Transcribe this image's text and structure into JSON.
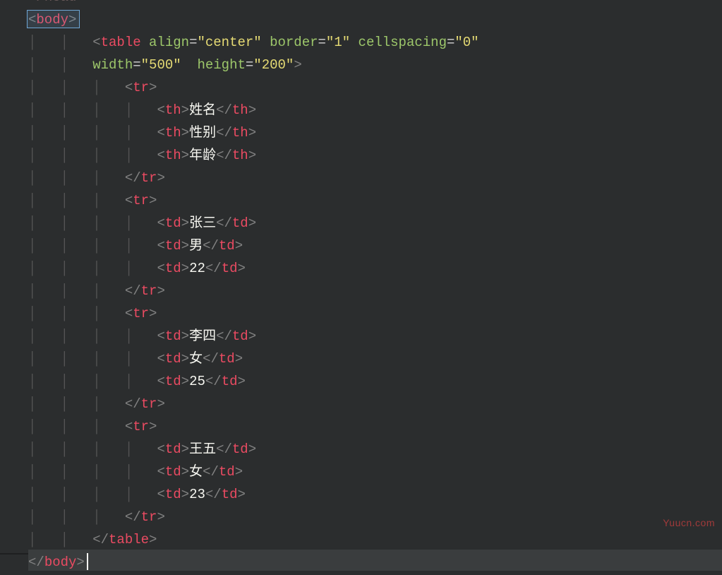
{
  "watermark": "Yuucn.com",
  "code": {
    "lines": [
      {
        "indent": 0,
        "sel": false,
        "tokens": [
          [
            "ig",
            "</"
          ],
          [
            "txt",
            "head"
          ],
          [
            "ig",
            ">"
          ]
        ],
        "faded": true
      },
      {
        "indent": 0,
        "sel": true,
        "tokens": [
          [
            "angle",
            "<"
          ],
          [
            "tag",
            "body"
          ],
          [
            "angle",
            ">"
          ]
        ]
      },
      {
        "indent": 2,
        "tokens": [
          [
            "angle",
            "<"
          ],
          [
            "tag",
            "table"
          ],
          [
            "txt",
            " "
          ],
          [
            "attr",
            "align"
          ],
          [
            "eq",
            "="
          ],
          [
            "str",
            "\"center\""
          ],
          [
            "txt",
            " "
          ],
          [
            "attr",
            "border"
          ],
          [
            "eq",
            "="
          ],
          [
            "str",
            "\"1\""
          ],
          [
            "txt",
            " "
          ],
          [
            "attr",
            "cellspacing"
          ],
          [
            "eq",
            "="
          ],
          [
            "str",
            "\"0\""
          ],
          [
            "txt",
            " "
          ]
        ]
      },
      {
        "indent": 2,
        "cont": true,
        "tokens": [
          [
            "attr",
            "width"
          ],
          [
            "eq",
            "="
          ],
          [
            "str",
            "\"500\""
          ],
          [
            "txt",
            "  "
          ],
          [
            "attr",
            "height"
          ],
          [
            "eq",
            "="
          ],
          [
            "str",
            "\"200\""
          ],
          [
            "angle",
            ">"
          ]
        ]
      },
      {
        "indent": 3,
        "tokens": [
          [
            "angle",
            "<"
          ],
          [
            "tag",
            "tr"
          ],
          [
            "angle",
            ">"
          ]
        ]
      },
      {
        "indent": 4,
        "tokens": [
          [
            "angle",
            "<"
          ],
          [
            "tag",
            "th"
          ],
          [
            "angle",
            ">"
          ],
          [
            "txt",
            "姓名"
          ],
          [
            "angle",
            "</"
          ],
          [
            "tag",
            "th"
          ],
          [
            "angle",
            ">"
          ]
        ]
      },
      {
        "indent": 4,
        "tokens": [
          [
            "angle",
            "<"
          ],
          [
            "tag",
            "th"
          ],
          [
            "angle",
            ">"
          ],
          [
            "txt",
            "性别"
          ],
          [
            "angle",
            "</"
          ],
          [
            "tag",
            "th"
          ],
          [
            "angle",
            ">"
          ]
        ]
      },
      {
        "indent": 4,
        "tokens": [
          [
            "angle",
            "<"
          ],
          [
            "tag",
            "th"
          ],
          [
            "angle",
            ">"
          ],
          [
            "txt",
            "年龄"
          ],
          [
            "angle",
            "</"
          ],
          [
            "tag",
            "th"
          ],
          [
            "angle",
            ">"
          ]
        ]
      },
      {
        "indent": 3,
        "tokens": [
          [
            "angle",
            "</"
          ],
          [
            "tag",
            "tr"
          ],
          [
            "angle",
            ">"
          ]
        ]
      },
      {
        "indent": 3,
        "guideShift": true,
        "tokens": [
          [
            "angle",
            "<"
          ],
          [
            "tag",
            "tr"
          ],
          [
            "angle",
            ">"
          ]
        ]
      },
      {
        "indent": 4,
        "tokens": [
          [
            "angle",
            "<"
          ],
          [
            "tag",
            "td"
          ],
          [
            "angle",
            ">"
          ],
          [
            "txt",
            "张三"
          ],
          [
            "angle",
            "</"
          ],
          [
            "tag",
            "td"
          ],
          [
            "angle",
            ">"
          ]
        ]
      },
      {
        "indent": 4,
        "tokens": [
          [
            "angle",
            "<"
          ],
          [
            "tag",
            "td"
          ],
          [
            "angle",
            ">"
          ],
          [
            "txt",
            "男"
          ],
          [
            "angle",
            "</"
          ],
          [
            "tag",
            "td"
          ],
          [
            "angle",
            ">"
          ]
        ]
      },
      {
        "indent": 4,
        "tokens": [
          [
            "angle",
            "<"
          ],
          [
            "tag",
            "td"
          ],
          [
            "angle",
            ">"
          ],
          [
            "txt",
            "22"
          ],
          [
            "angle",
            "</"
          ],
          [
            "tag",
            "td"
          ],
          [
            "angle",
            ">"
          ]
        ]
      },
      {
        "indent": 3,
        "guideShift": true,
        "tokens": [
          [
            "angle",
            "</"
          ],
          [
            "tag",
            "tr"
          ],
          [
            "angle",
            ">"
          ]
        ]
      },
      {
        "indent": 3,
        "guideShift": true,
        "tokens": [
          [
            "angle",
            "<"
          ],
          [
            "tag",
            "tr"
          ],
          [
            "angle",
            ">"
          ]
        ]
      },
      {
        "indent": 4,
        "tokens": [
          [
            "angle",
            "<"
          ],
          [
            "tag",
            "td"
          ],
          [
            "angle",
            ">"
          ],
          [
            "txt",
            "李四"
          ],
          [
            "angle",
            "</"
          ],
          [
            "tag",
            "td"
          ],
          [
            "angle",
            ">"
          ]
        ]
      },
      {
        "indent": 4,
        "tokens": [
          [
            "angle",
            "<"
          ],
          [
            "tag",
            "td"
          ],
          [
            "angle",
            ">"
          ],
          [
            "txt",
            "女"
          ],
          [
            "angle",
            "</"
          ],
          [
            "tag",
            "td"
          ],
          [
            "angle",
            ">"
          ]
        ]
      },
      {
        "indent": 4,
        "tokens": [
          [
            "angle",
            "<"
          ],
          [
            "tag",
            "td"
          ],
          [
            "angle",
            ">"
          ],
          [
            "txt",
            "25"
          ],
          [
            "angle",
            "</"
          ],
          [
            "tag",
            "td"
          ],
          [
            "angle",
            ">"
          ]
        ]
      },
      {
        "indent": 3,
        "guideShift": true,
        "tokens": [
          [
            "angle",
            "</"
          ],
          [
            "tag",
            "tr"
          ],
          [
            "angle",
            ">"
          ]
        ]
      },
      {
        "indent": 3,
        "guideShift": true,
        "tokens": [
          [
            "angle",
            "<"
          ],
          [
            "tag",
            "tr"
          ],
          [
            "angle",
            ">"
          ]
        ]
      },
      {
        "indent": 4,
        "tokens": [
          [
            "angle",
            "<"
          ],
          [
            "tag",
            "td"
          ],
          [
            "angle",
            ">"
          ],
          [
            "txt",
            "王五"
          ],
          [
            "angle",
            "</"
          ],
          [
            "tag",
            "td"
          ],
          [
            "angle",
            ">"
          ]
        ]
      },
      {
        "indent": 4,
        "tokens": [
          [
            "angle",
            "<"
          ],
          [
            "tag",
            "td"
          ],
          [
            "angle",
            ">"
          ],
          [
            "txt",
            "女"
          ],
          [
            "angle",
            "</"
          ],
          [
            "tag",
            "td"
          ],
          [
            "angle",
            ">"
          ]
        ]
      },
      {
        "indent": 4,
        "tokens": [
          [
            "angle",
            "<"
          ],
          [
            "tag",
            "td"
          ],
          [
            "angle",
            ">"
          ],
          [
            "txt",
            "23"
          ],
          [
            "angle",
            "</"
          ],
          [
            "tag",
            "td"
          ],
          [
            "angle",
            ">"
          ]
        ]
      },
      {
        "indent": 3,
        "guideShift": true,
        "tokens": [
          [
            "angle",
            "</"
          ],
          [
            "tag",
            "tr"
          ],
          [
            "angle",
            ">"
          ]
        ]
      },
      {
        "indent": 2,
        "tokens": [
          [
            "angle",
            "</"
          ],
          [
            "tag",
            "table"
          ],
          [
            "angle",
            ">"
          ]
        ]
      },
      {
        "indent": 0,
        "hl": true,
        "cursorAfter": true,
        "tokens": [
          [
            "angle",
            "</"
          ],
          [
            "tag",
            "body"
          ],
          [
            "angle",
            ">"
          ]
        ]
      }
    ]
  }
}
